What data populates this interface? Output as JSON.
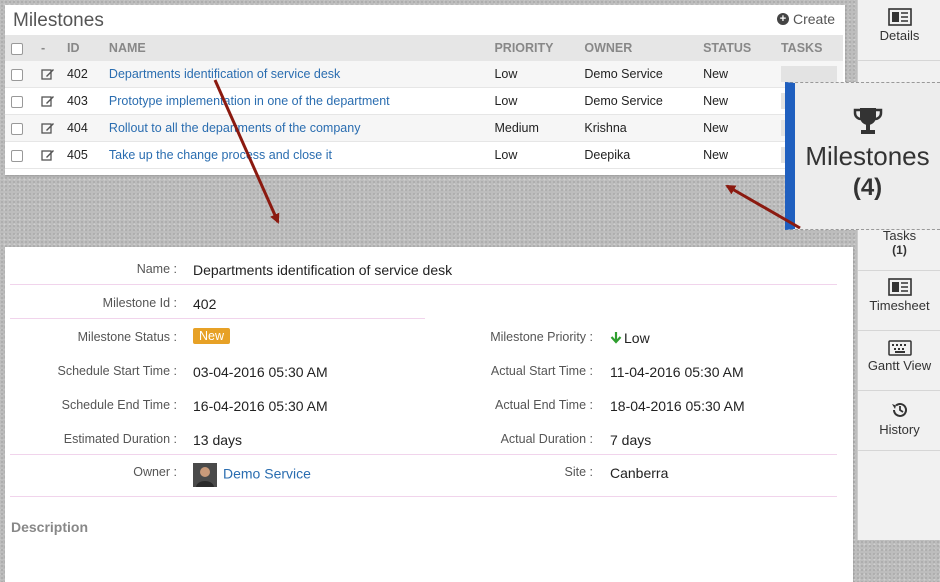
{
  "list": {
    "title": "Milestones",
    "create_label": "Create",
    "columns": {
      "select": "",
      "edit": "-",
      "id": "ID",
      "name": "NAME",
      "priority": "PRIORITY",
      "owner": "OWNER",
      "status": "STATUS",
      "tasks": "TASKS"
    },
    "rows": [
      {
        "id": "402",
        "name": "Departments identification of service desk",
        "priority": "Low",
        "owner": "Demo Service",
        "status": "New"
      },
      {
        "id": "403",
        "name": "Prototype implementation in one of the department",
        "priority": "Low",
        "owner": "Demo Service",
        "status": "New"
      },
      {
        "id": "404",
        "name": "Rollout to all the departments of the company",
        "priority": "Medium",
        "owner": "Krishna",
        "status": "New"
      },
      {
        "id": "405",
        "name": "Take up the change process and close it",
        "priority": "Low",
        "owner": "Deepika",
        "status": "New"
      }
    ]
  },
  "sidebar": {
    "details": "Details",
    "tasks": "Tasks",
    "tasks_count": "(1)",
    "timesheet": "Timesheet",
    "gantt": "Gantt View",
    "history": "History"
  },
  "callout": {
    "label": "Milestones",
    "count": "(4)"
  },
  "details": {
    "name_label": "Name :",
    "name_value": "Departments identification of service desk",
    "id_label": "Milestone Id :",
    "id_value": "402",
    "status_label": "Milestone Status :",
    "status_value": "New",
    "priority_label": "Milestone Priority :",
    "priority_value": "Low",
    "sched_start_label": "Schedule Start Time :",
    "sched_start_value": "03-04-2016 05:30 AM",
    "actual_start_label": "Actual Start Time :",
    "actual_start_value": "11-04-2016 05:30 AM",
    "sched_end_label": "Schedule End Time :",
    "sched_end_value": "16-04-2016 05:30 AM",
    "actual_end_label": "Actual End Time :",
    "actual_end_value": "18-04-2016 05:30 AM",
    "est_dur_label": "Estimated Duration :",
    "est_dur_value": "13 days",
    "act_dur_label": "Actual Duration :",
    "act_dur_value": "7 days",
    "owner_label": "Owner :",
    "owner_value": "Demo Service",
    "site_label": "Site :",
    "site_value": "Canberra",
    "description_title": "Description"
  },
  "colors": {
    "accent": "#2a6db0",
    "badge": "#e7a126",
    "callout_bar": "#1f5fbf",
    "arrow": "#8b1a10",
    "priority_low": "#2e9e2e"
  }
}
